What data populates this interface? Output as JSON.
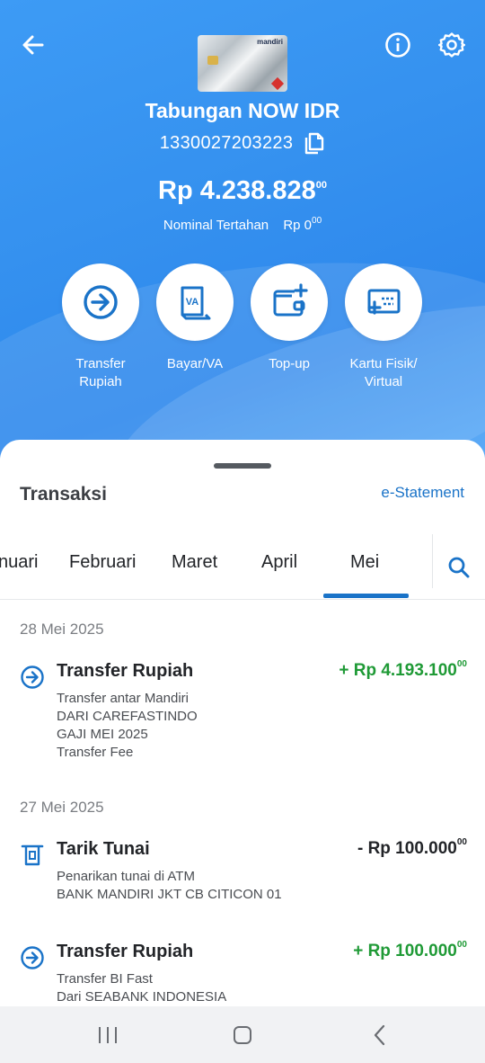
{
  "header": {
    "account_name": "Tabungan NOW IDR",
    "account_number": "1330027203223",
    "balance_main": "Rp 4.238.828",
    "balance_cents": "00",
    "hold_label": "Nominal Tertahan",
    "hold_value": "Rp 0",
    "hold_cents": "00",
    "card_brand": "mandiri"
  },
  "actions": [
    {
      "label": "Transfer\nRupiah",
      "icon": "transfer-icon"
    },
    {
      "label": "Bayar/VA",
      "icon": "va-icon"
    },
    {
      "label": "Top-up",
      "icon": "wallet-icon"
    },
    {
      "label": "Kartu Fisik/\nVirtual",
      "icon": "card-icon"
    }
  ],
  "sheet": {
    "title": "Transaksi",
    "estatement": "e-Statement"
  },
  "months": [
    "nuari",
    "Februari",
    "Maret",
    "April",
    "Mei"
  ],
  "selected_month": "Mei",
  "transactions": [
    {
      "date": "28 Mei 2025",
      "title": "Transfer Rupiah",
      "amount": "+ Rp 4.193.100",
      "cents": "00",
      "type": "credit",
      "desc": [
        "Transfer antar Mandiri",
        "DARI CAREFASTINDO",
        "GAJI MEI 2025",
        "Transfer Fee"
      ]
    },
    {
      "date": "27 Mei 2025",
      "title": "Tarik Tunai",
      "amount": "- Rp 100.000",
      "cents": "00",
      "type": "debit",
      "desc": [
        "Penarikan tunai di ATM",
        "BANK MANDIRI JKT CB CITICON 01"
      ]
    },
    {
      "date": "",
      "title": "Transfer Rupiah",
      "amount": "+ Rp 100.000",
      "cents": "00",
      "type": "credit",
      "desc": [
        "Transfer BI Fast",
        "Dari SEABANK INDONESIA"
      ]
    }
  ],
  "colors": {
    "header_blue": "#3591ef",
    "accent_blue": "#1a73c8",
    "credit_green": "#1f9a36"
  }
}
